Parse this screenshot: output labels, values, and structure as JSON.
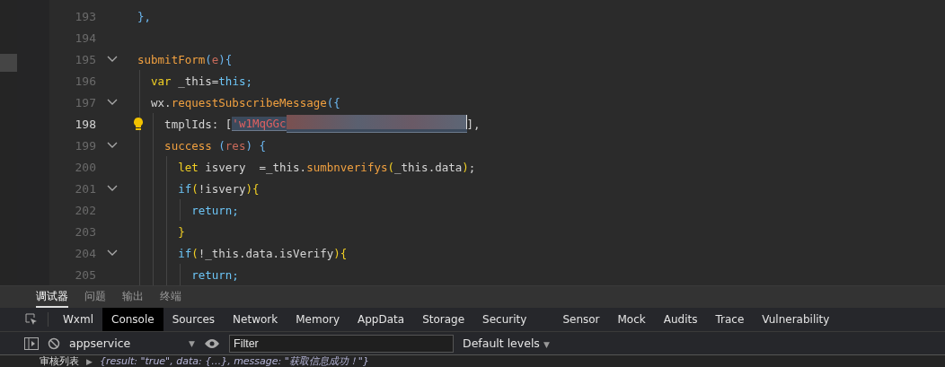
{
  "editor": {
    "lines": [
      {
        "number": "193",
        "foldable": false,
        "active": false,
        "tokens": [
          {
            "kind": "brace",
            "text": "},"
          }
        ]
      },
      {
        "number": "194",
        "foldable": false,
        "active": false
      },
      {
        "number": "195",
        "foldable": true,
        "active": false,
        "tokens": [
          {
            "kind": "func",
            "text": "submitForm"
          },
          {
            "kind": "brace",
            "text": "("
          },
          {
            "kind": "param",
            "text": "e"
          },
          {
            "kind": "brace",
            "text": "){"
          }
        ]
      },
      {
        "number": "196",
        "foldable": false,
        "active": false,
        "tokens": [
          {
            "kind": "keyword",
            "text": "  var"
          },
          {
            "kind": "plain",
            "text": " _this="
          },
          {
            "kind": "this",
            "text": "this;"
          }
        ]
      },
      {
        "number": "197",
        "foldable": true,
        "active": false,
        "tokens": [
          {
            "kind": "plain",
            "text": "  wx."
          },
          {
            "kind": "func",
            "text": "requestSubscribeMessage"
          },
          {
            "kind": "brace",
            "text": "({"
          }
        ]
      },
      {
        "number": "198",
        "foldable": false,
        "active": true,
        "tokens": [
          {
            "kind": "plain",
            "text": "    tmplIds: ["
          },
          {
            "kind": "string",
            "text": "'w1MqGGc"
          },
          {
            "kind": "redacted"
          },
          {
            "kind": "plain",
            "text": "],"
          }
        ]
      },
      {
        "number": "199",
        "foldable": true,
        "active": false,
        "tokens": [
          {
            "kind": "func",
            "text": "    success "
          },
          {
            "kind": "brace",
            "text": "("
          },
          {
            "kind": "param",
            "text": "res"
          },
          {
            "kind": "brace",
            "text": ") {"
          }
        ]
      },
      {
        "number": "200",
        "foldable": false,
        "active": false,
        "tokens": [
          {
            "kind": "keyword",
            "text": "      let"
          },
          {
            "kind": "plain",
            "text": " isvery  =_this."
          },
          {
            "kind": "func",
            "text": "sumbnverifys"
          },
          {
            "kind": "keyword",
            "text": "("
          },
          {
            "kind": "plain",
            "text": "_this.data"
          },
          {
            "kind": "keyword",
            "text": ")"
          },
          {
            "kind": "plain",
            "text": ";"
          }
        ]
      },
      {
        "number": "201",
        "foldable": true,
        "active": false,
        "tokens": [
          {
            "kind": "this",
            "text": "      if"
          },
          {
            "kind": "keyword",
            "text": "("
          },
          {
            "kind": "plain",
            "text": "!isvery"
          },
          {
            "kind": "keyword",
            "text": "){"
          }
        ]
      },
      {
        "number": "202",
        "foldable": false,
        "active": false,
        "tokens": [
          {
            "kind": "this",
            "text": "        return;"
          }
        ]
      },
      {
        "number": "203",
        "foldable": false,
        "active": false,
        "tokens": [
          {
            "kind": "keyword",
            "text": "      }"
          }
        ]
      },
      {
        "number": "204",
        "foldable": true,
        "active": false,
        "tokens": [
          {
            "kind": "this",
            "text": "      if"
          },
          {
            "kind": "keyword",
            "text": "("
          },
          {
            "kind": "plain",
            "text": "!_this.data.isVerify"
          },
          {
            "kind": "keyword",
            "text": "){"
          }
        ]
      },
      {
        "number": "205",
        "foldable": false,
        "active": false,
        "tokens": [
          {
            "kind": "this",
            "text": "        return;"
          }
        ]
      }
    ]
  },
  "panel_tabs": [
    {
      "label": "调试器",
      "selected": true
    },
    {
      "label": "问题",
      "selected": false
    },
    {
      "label": "输出",
      "selected": false
    },
    {
      "label": "终端",
      "selected": false
    }
  ],
  "devtools_tabs": [
    {
      "label": "Wxml",
      "selected": false
    },
    {
      "label": "Console",
      "selected": true
    },
    {
      "label": "Sources",
      "selected": false
    },
    {
      "label": "Network",
      "selected": false
    },
    {
      "label": "Memory",
      "selected": false
    },
    {
      "label": "AppData",
      "selected": false
    },
    {
      "label": "Storage",
      "selected": false
    },
    {
      "label": "Security",
      "selected": false
    },
    {
      "label": "Sensor",
      "selected": false
    },
    {
      "label": "Mock",
      "selected": false
    },
    {
      "label": "Audits",
      "selected": false
    },
    {
      "label": "Trace",
      "selected": false
    },
    {
      "label": "Vulnerability",
      "selected": false
    }
  ],
  "console_toolbar": {
    "context": "appservice",
    "context_arrow": "▼",
    "filter": {
      "placeholder": "Filter"
    },
    "levels": "Default levels",
    "levels_arrow": "▼"
  },
  "console_rows": [
    {
      "label": "审核列表",
      "expander": "▶",
      "value": "{result: \"true\", data: {…}, message: \"获取信息成功！\"}"
    }
  ]
}
